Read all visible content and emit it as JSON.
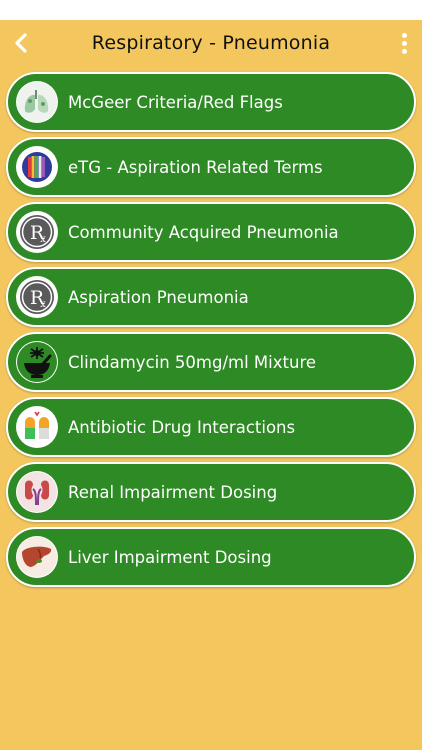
{
  "header": {
    "title": "Respiratory - Pneumonia"
  },
  "list": {
    "items": [
      {
        "label": "McGeer Criteria/Red Flags",
        "icon": "lungs-icon"
      },
      {
        "label": "eTG - Aspiration Related Terms",
        "icon": "books-icon"
      },
      {
        "label": "Community Acquired Pneumonia",
        "icon": "rx-icon"
      },
      {
        "label": "Aspiration Pneumonia",
        "icon": "rx-icon"
      },
      {
        "label": "Clindamycin 50mg/ml Mixture",
        "icon": "mortar-pestle-icon"
      },
      {
        "label": "Antibiotic Drug Interactions",
        "icon": "capsules-icon"
      },
      {
        "label": "Renal Impairment Dosing",
        "icon": "kidney-icon"
      },
      {
        "label": "Liver Impairment Dosing",
        "icon": "liver-icon"
      }
    ]
  },
  "colors": {
    "background": "#f4c75e",
    "item": "#2e8a24",
    "item_border": "#ffffff"
  }
}
